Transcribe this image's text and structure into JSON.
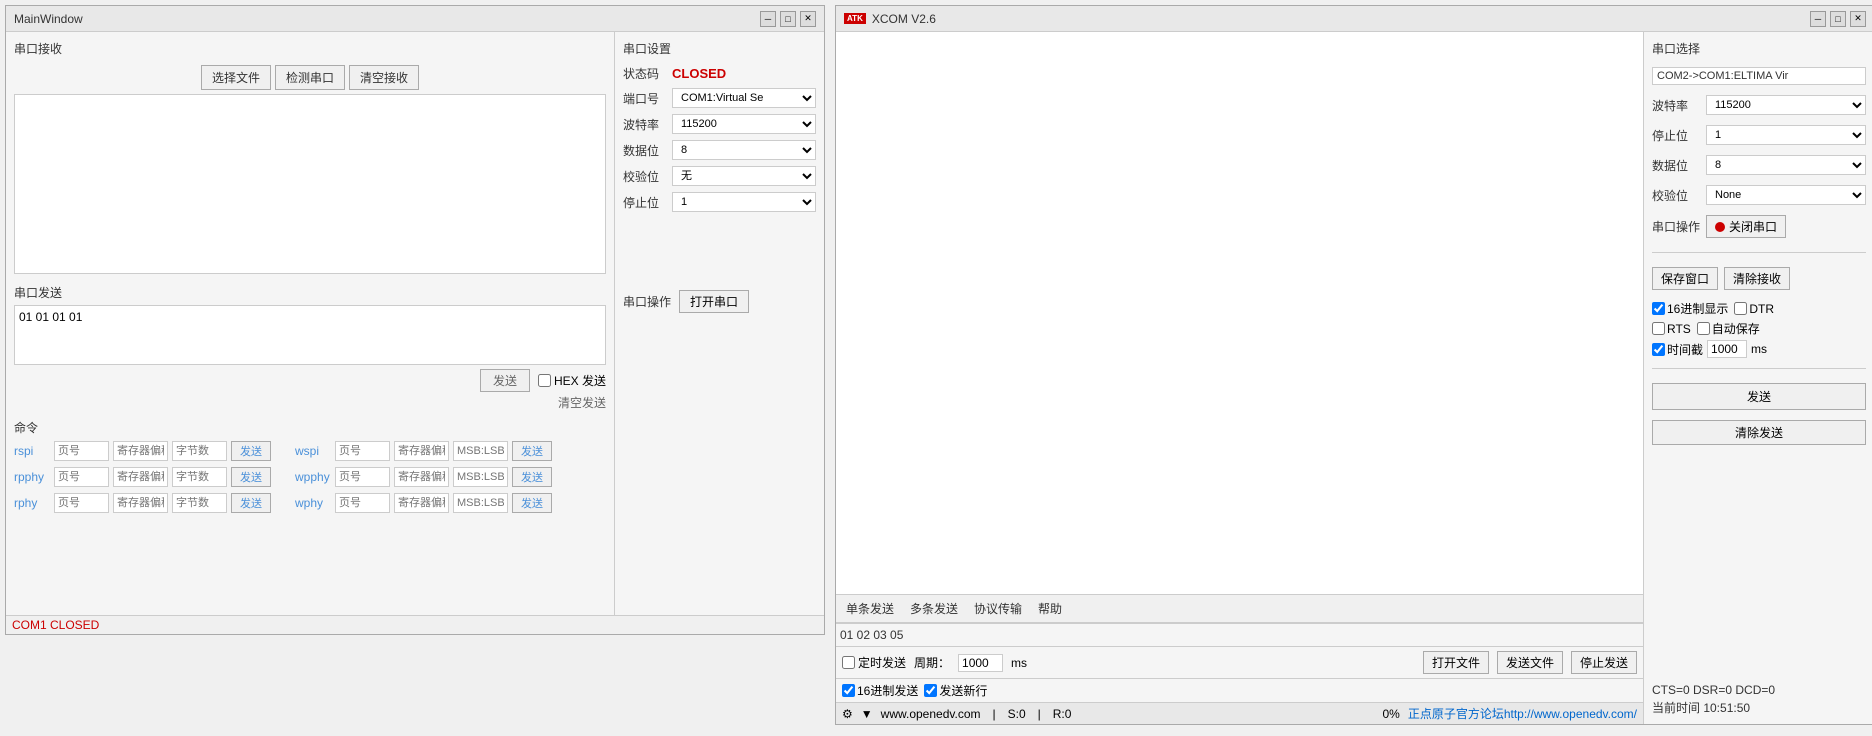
{
  "mainWindow": {
    "title": "MainWindow",
    "controls": {
      "minimize": "─",
      "maximize": "□",
      "close": "✕"
    },
    "sections": {
      "receive": {
        "title": "串口接收",
        "buttons": {
          "selectFile": "选择文件",
          "detectPort": "检测串口",
          "clearReceive": "清空接收"
        }
      },
      "send": {
        "title": "串口发送",
        "content": "01 01 01 01",
        "sendBtn": "发送",
        "hexSend": "HEX 发送",
        "clearSend": "清空发送"
      },
      "command": {
        "title": "命令",
        "rows": [
          {
            "name": "rspi",
            "inputs": [
              "页号",
              "寄存器偏移",
              "字节数"
            ],
            "sendBtn": "发送",
            "right": {
              "name": "wspi",
              "inputs": [
                "页号",
                "寄存器偏移",
                "MSB:LSB"
              ],
              "sendBtn": "发送"
            }
          },
          {
            "name": "rpphy",
            "inputs": [
              "页号",
              "寄存器偏移",
              "字节数"
            ],
            "sendBtn": "发送",
            "right": {
              "name": "wpphy",
              "inputs": [
                "页号",
                "寄存器偏移",
                "MSB:LSB"
              ],
              "sendBtn": "发送"
            }
          },
          {
            "name": "rphy",
            "inputs": [
              "页号",
              "寄存器偏移",
              "字节数"
            ],
            "sendBtn": "发送",
            "right": {
              "name": "wphy",
              "inputs": [
                "页号",
                "寄存器偏移",
                "MSB:LSB"
              ],
              "sendBtn": "发送"
            }
          }
        ]
      }
    },
    "serialSettings": {
      "title": "串口设置",
      "status": {
        "label": "状态码",
        "value": "CLOSED"
      },
      "port": {
        "label": "端口号",
        "value": "COM1:Virtual Se"
      },
      "baud": {
        "label": "波特率",
        "value": "115200"
      },
      "dataBits": {
        "label": "数据位",
        "value": "8"
      },
      "parity": {
        "label": "校验位",
        "value": "无"
      },
      "stopBits": {
        "label": "停止位",
        "value": "1"
      },
      "operations": {
        "label": "串口操作",
        "openBtn": "打开串口"
      }
    },
    "statusBar": "COM1 CLOSED"
  },
  "xcomWindow": {
    "title": "XCOM V2.6",
    "logoText": "ATK",
    "controls": {
      "minimize": "─",
      "maximize": "□",
      "close": "✕"
    },
    "tabs": [
      "单条发送",
      "多条发送",
      "协议传输",
      "帮助"
    ],
    "sendContent": "01 02 03 05",
    "rightPanel": {
      "serialSelect": {
        "label": "串口选择",
        "value": "COM2->COM1:ELTIMA Vir"
      },
      "baud": {
        "label": "波特率",
        "value": "115200"
      },
      "stopBits": {
        "label": "停止位",
        "value": "1"
      },
      "dataBits": {
        "label": "数据位",
        "value": "8"
      },
      "parity": {
        "label": "校验位",
        "value": "None"
      },
      "operations": {
        "label": "串口操作",
        "closeBtn": "关闭串口"
      },
      "saveWindow": "保存窗口",
      "clearReceive": "清除接收",
      "checkboxes": {
        "hexDisplay": "16进制显示",
        "dtr": "DTR",
        "rts": "RTS",
        "autoSave": "自动保存",
        "timestamp": "时间截",
        "timestampValue": "1000",
        "timestampUnit": "ms"
      },
      "sendBtn": "发送",
      "clearSend": "清除发送"
    },
    "sendControls": {
      "timedSend": "定时发送",
      "period": "周期：",
      "periodValue": "1000",
      "periodUnit": "ms",
      "openFile": "打开文件",
      "sendFile": "发送文件",
      "stopSend": "停止发送"
    },
    "sendControls2": {
      "hexSend": "16进制发送",
      "newline": "发送新行"
    },
    "statusBar": {
      "progress": "0%",
      "link": "正点原子官方论坛http://www.openedv.com/",
      "gearIcon": "⚙",
      "dropdown": "▼",
      "website": "www.openedv.com",
      "s": "S:0",
      "r": "R:0",
      "cts": "CTS=0 DSR=0 DCD=0",
      "time": "当前时间 10:51:50"
    }
  }
}
